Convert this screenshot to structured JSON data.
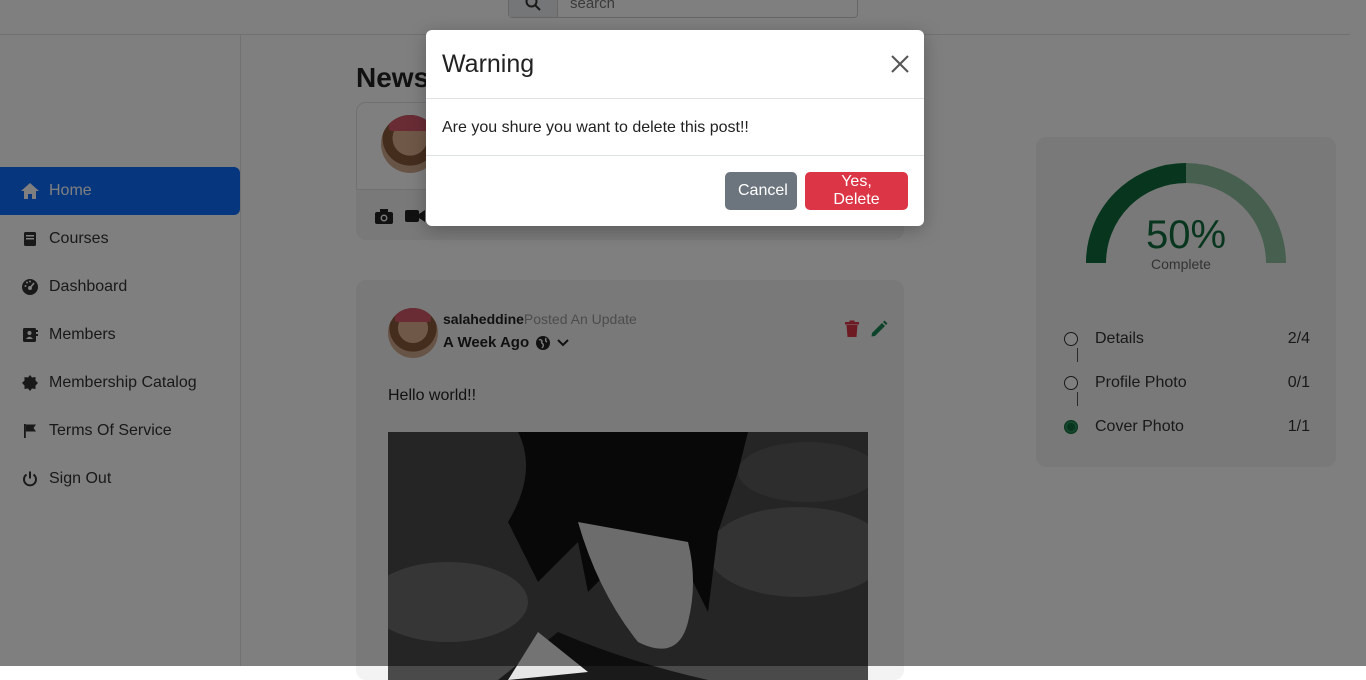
{
  "search": {
    "placeholder": "search"
  },
  "sidebar": {
    "items": [
      {
        "label": "Home",
        "icon": "home-icon",
        "active": true
      },
      {
        "label": "Courses",
        "icon": "book-icon",
        "active": false
      },
      {
        "label": "Dashboard",
        "icon": "dashboard-gauge-icon",
        "active": false
      },
      {
        "label": "Members",
        "icon": "address-book-icon",
        "active": false
      },
      {
        "label": "Membership Catalog",
        "icon": "badge-icon",
        "active": false
      },
      {
        "label": "Terms Of Service",
        "icon": "flag-icon",
        "active": false
      },
      {
        "label": "Sign Out",
        "icon": "power-icon",
        "active": false
      }
    ]
  },
  "feed": {
    "title": "News",
    "composer": {
      "icons": [
        "camera-icon",
        "video-icon"
      ]
    },
    "post": {
      "author": "salaheddine",
      "action": "Posted An Update",
      "time": "A Week Ago",
      "text": "Hello world!!"
    }
  },
  "progress": {
    "percent_label": "50%",
    "percent": 50,
    "complete_label": "Complete",
    "steps": [
      {
        "label": "Details",
        "count": "2/4",
        "done": false
      },
      {
        "label": "Profile Photo",
        "count": "0/1",
        "done": false
      },
      {
        "label": "Cover Photo",
        "count": "1/1",
        "done": true
      }
    ]
  },
  "modal": {
    "title": "Warning",
    "message": "Are you shure you want to delete this post!!",
    "cancel_label": "Cancel",
    "confirm_label": "Yes, Delete"
  },
  "colors": {
    "primary": "#0d6efd",
    "danger": "#dc3545",
    "secondary": "#6c757d",
    "gauge": "#0f6b3a"
  }
}
